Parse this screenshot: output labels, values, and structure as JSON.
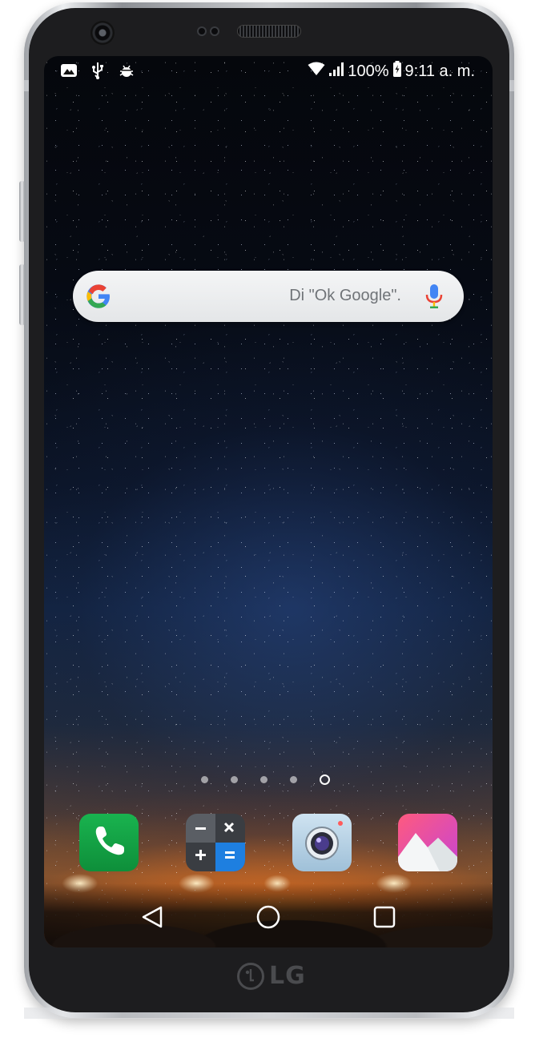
{
  "device": {
    "brand_logo": "LG",
    "frame_color": "#1d1d1f"
  },
  "status_bar": {
    "left_icons": [
      "gallery-notification-icon",
      "usb-icon",
      "android-debug-icon"
    ],
    "wifi_icon": "wifi-icon",
    "signal_icon": "signal-bars-icon",
    "battery_percent": "100%",
    "battery_icon": "battery-charging-icon",
    "time": "9:11 a. m."
  },
  "search_widget": {
    "logo": "google-g-icon",
    "hint": "Di \"Ok Google\".",
    "mic": "microphone-icon"
  },
  "home_pages": {
    "count": 5,
    "active_index": 4
  },
  "dock": {
    "apps": [
      {
        "name": "phone-app-icon",
        "color": "#19b34f"
      },
      {
        "name": "calculator-app-icon",
        "color": "#3a3d42"
      },
      {
        "name": "camera-app-icon",
        "color": "#b8d3e6"
      },
      {
        "name": "gallery-app-icon",
        "color": "#e34fa8"
      }
    ]
  },
  "nav_bar": {
    "buttons": [
      "back-button",
      "home-button",
      "recents-button"
    ]
  }
}
